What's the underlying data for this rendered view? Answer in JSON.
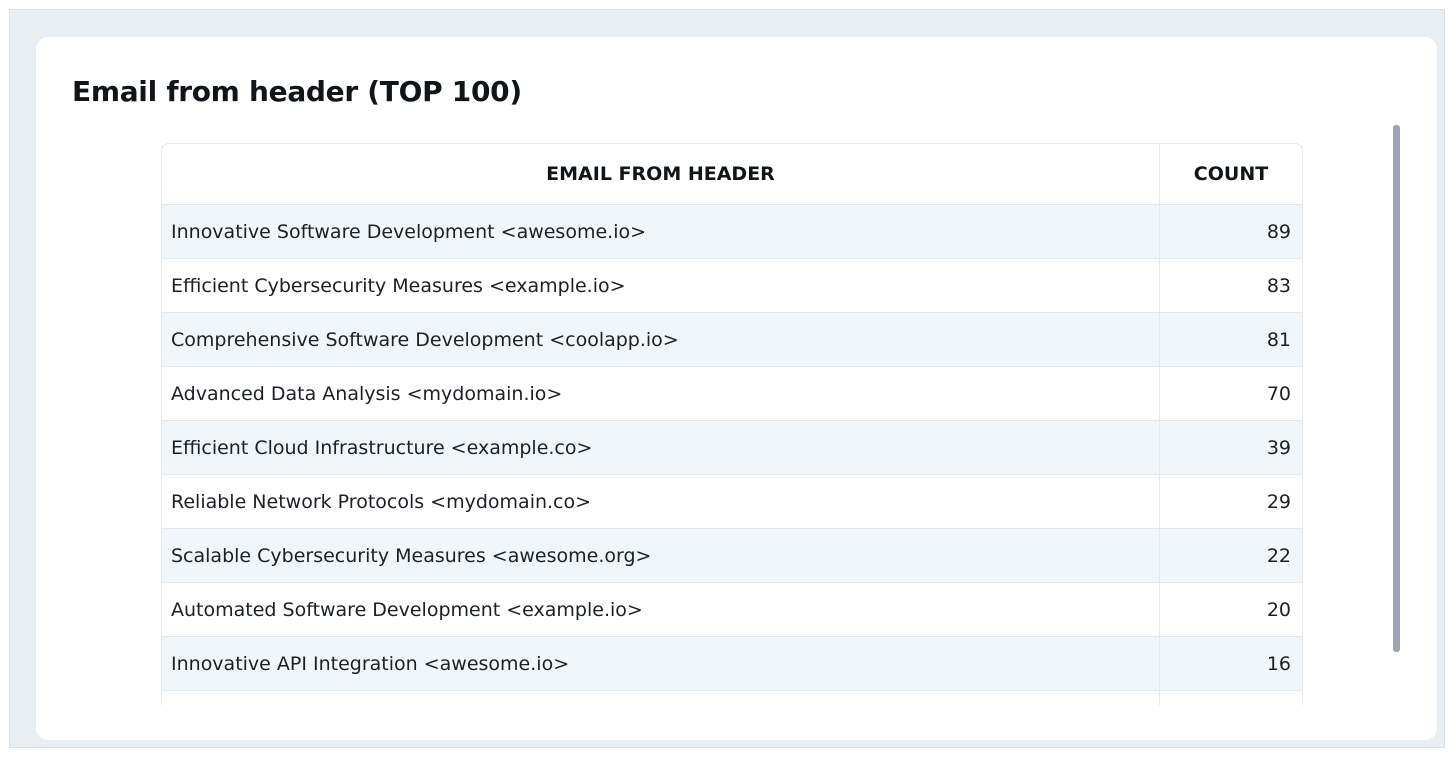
{
  "panel": {
    "title": "Email from header (TOP 100)"
  },
  "table": {
    "columns": {
      "email": "EMAIL FROM HEADER",
      "count": "COUNT"
    },
    "rows": [
      {
        "email": "Innovative Software Development <awesome.io>",
        "count": "89"
      },
      {
        "email": "Efficient Cybersecurity Measures <example.io>",
        "count": "83"
      },
      {
        "email": "Comprehensive Software Development <coolapp.io>",
        "count": "81"
      },
      {
        "email": "Advanced Data Analysis <mydomain.io>",
        "count": "70"
      },
      {
        "email": "Efficient Cloud Infrastructure <example.co>",
        "count": "39"
      },
      {
        "email": "Reliable Network Protocols <mydomain.co>",
        "count": "29"
      },
      {
        "email": "Scalable Cybersecurity Measures <awesome.org>",
        "count": "22"
      },
      {
        "email": "Automated Software Development <example.io>",
        "count": "20"
      },
      {
        "email": "Innovative API Integration <awesome.io>",
        "count": "16"
      }
    ]
  }
}
